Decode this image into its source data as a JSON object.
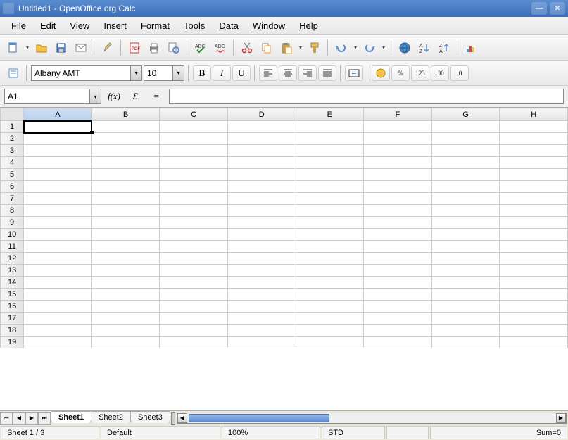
{
  "window": {
    "title": "Untitled1 - OpenOffice.org Calc"
  },
  "menu": [
    "File",
    "Edit",
    "View",
    "Insert",
    "Format",
    "Tools",
    "Data",
    "Window",
    "Help"
  ],
  "toolbar2": {
    "font": "Albany AMT",
    "size": "10",
    "bold": "B",
    "italic": "I",
    "under": "U",
    "curr": "%",
    "num": "123",
    "dec1": ".00",
    "dec2": ".0"
  },
  "formula": {
    "cellref": "A1",
    "fx": "f(x)",
    "sigma": "Σ",
    "eq": "="
  },
  "columns": [
    "A",
    "B",
    "C",
    "D",
    "E",
    "F",
    "G",
    "H"
  ],
  "rows": [
    "1",
    "2",
    "3",
    "4",
    "5",
    "6",
    "7",
    "8",
    "9",
    "10",
    "11",
    "12",
    "13",
    "14",
    "15",
    "16",
    "17",
    "18",
    "19"
  ],
  "active_col": "A",
  "active_row": "1",
  "tabs": {
    "items": [
      "Sheet1",
      "Sheet2",
      "Sheet3"
    ],
    "active": 0
  },
  "status": {
    "sheet": "Sheet 1 / 3",
    "style": "Default",
    "zoom": "100%",
    "mode": "STD",
    "sum": "Sum=0"
  }
}
